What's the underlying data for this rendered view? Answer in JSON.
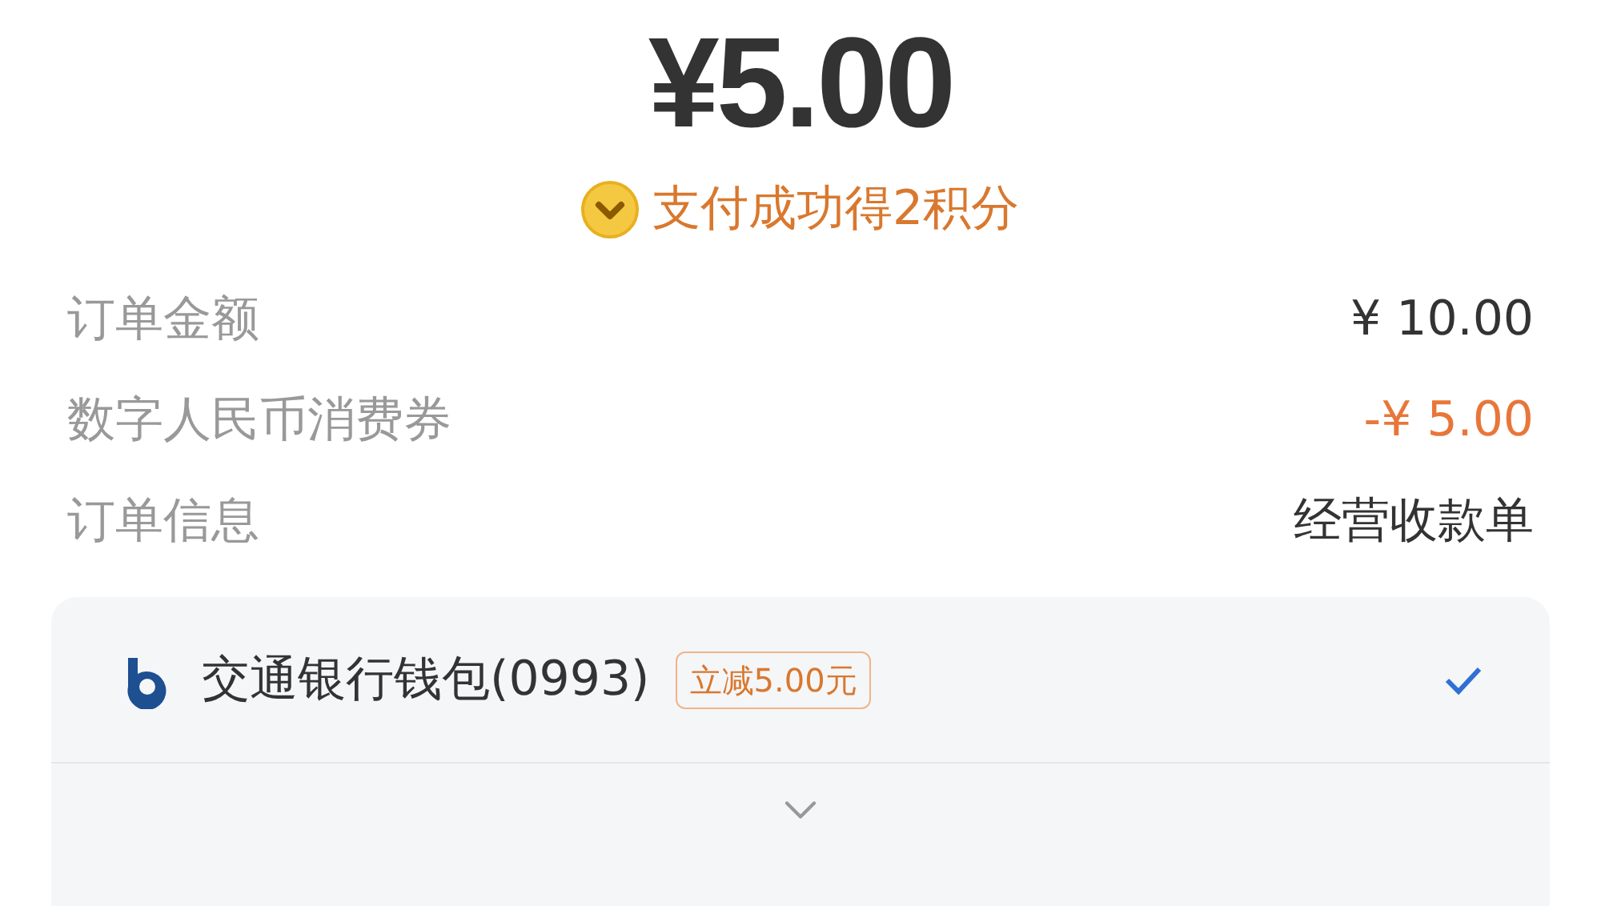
{
  "amount": "¥5.00",
  "points_note": "支付成功得2积分",
  "details": [
    {
      "label": "订单金额",
      "value": "¥ 10.00",
      "kind": "normal"
    },
    {
      "label": "数字人民币消费券",
      "value": "-¥ 5.00",
      "kind": "discount"
    },
    {
      "label": "订单信息",
      "value": "经营收款单",
      "kind": "normal"
    }
  ],
  "payment": {
    "name": "交通银行钱包(0993)",
    "badge": "立减5.00元",
    "selected": true
  }
}
